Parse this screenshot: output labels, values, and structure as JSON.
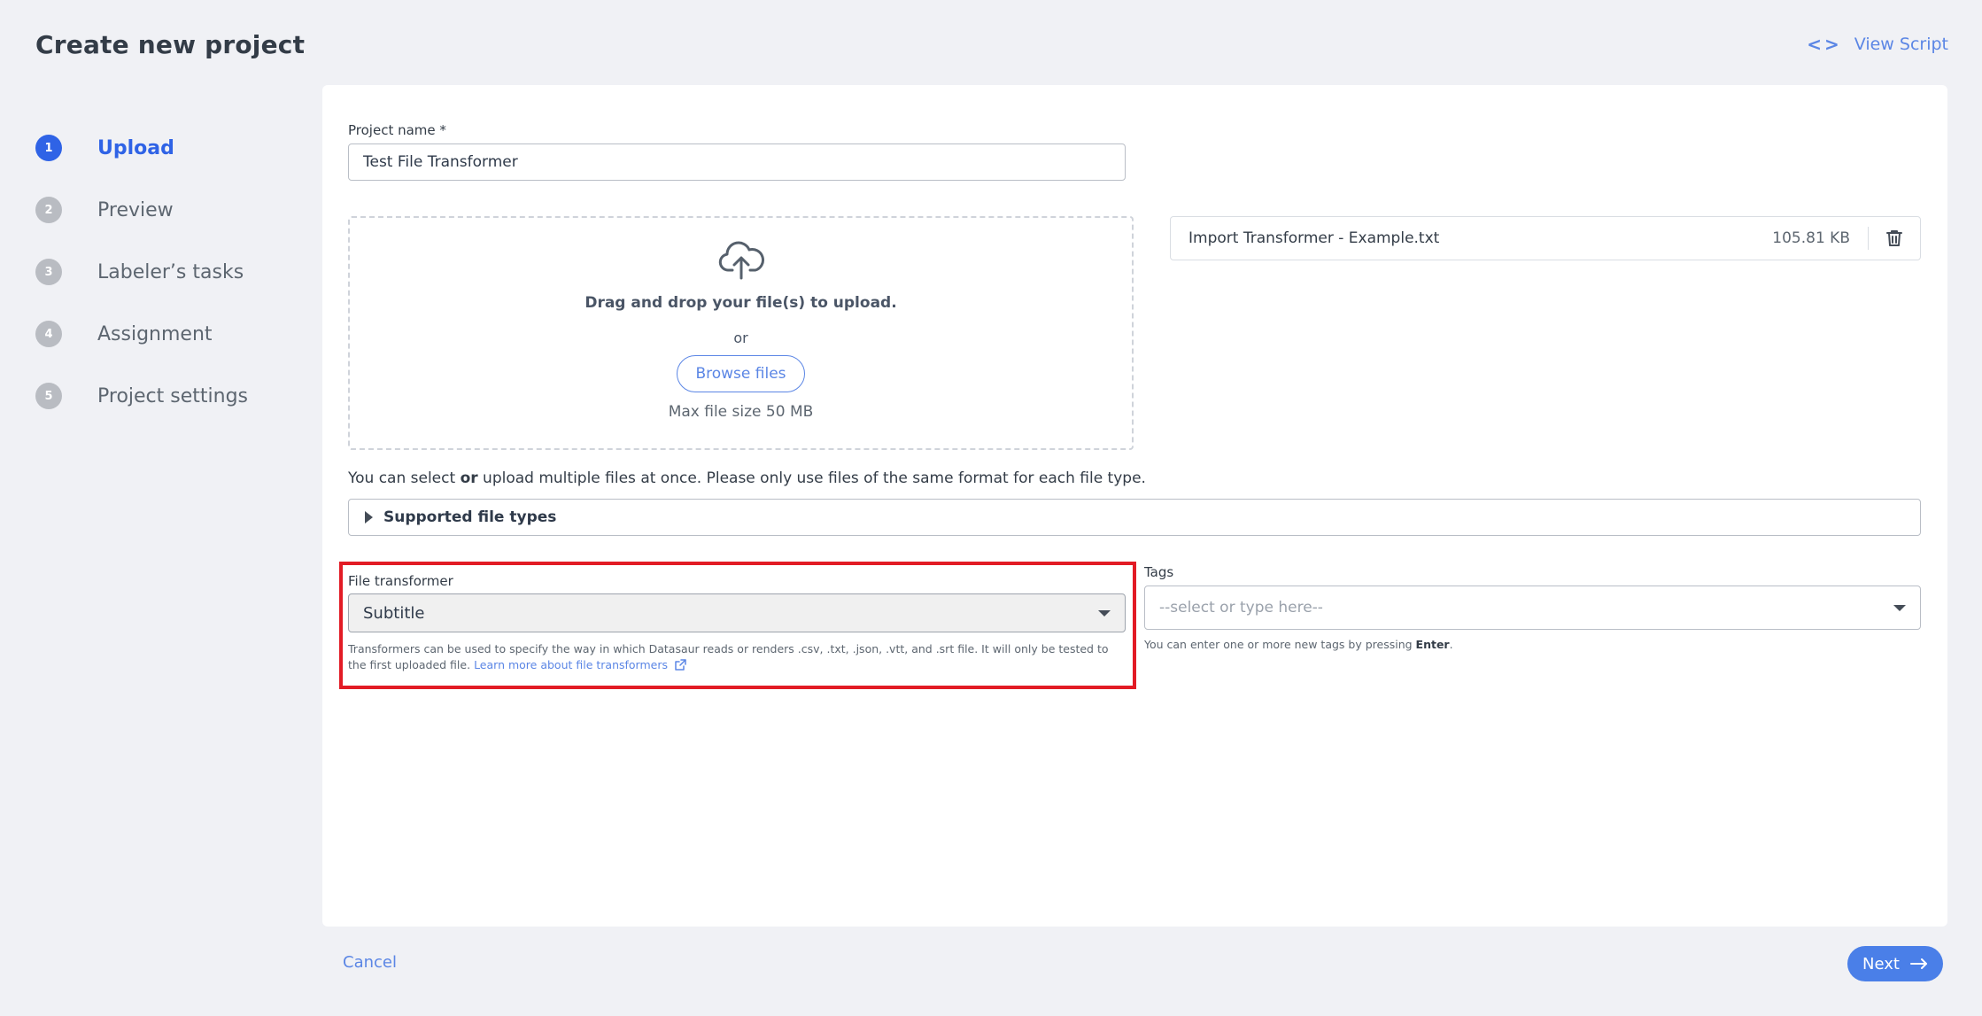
{
  "header": {
    "title": "Create new project",
    "view_script_label": "View Script",
    "view_script_icon": "code-icon"
  },
  "stepper": {
    "steps": [
      {
        "number": "1",
        "label": "Upload",
        "active": true
      },
      {
        "number": "2",
        "label": "Preview",
        "active": false
      },
      {
        "number": "3",
        "label": "Labeler’s tasks",
        "active": false
      },
      {
        "number": "4",
        "label": "Assignment",
        "active": false
      },
      {
        "number": "5",
        "label": "Project settings",
        "active": false
      }
    ]
  },
  "form": {
    "project_name": {
      "label": "Project name *",
      "value": "Test File Transformer"
    },
    "dropzone": {
      "icon": "cloud-upload-icon",
      "title": "Drag and drop your file(s) to upload.",
      "or_text": "or",
      "browse_label": "Browse files",
      "max_size": "Max file size 50 MB"
    },
    "uploaded_file": {
      "name": "Import Transformer - Example.txt",
      "size": "105.81 KB",
      "delete_icon": "trash-icon"
    },
    "select_note": {
      "before": "You can select ",
      "bold": "or",
      "after": " upload multiple files at once. Please only use files of the same format for each file type."
    },
    "supported_file_types": "Supported file types",
    "file_transformer": {
      "label": "File transformer",
      "value": "Subtitle",
      "help_text": "Transformers can be used to specify the way in which Datasaur reads or renders .csv, .txt, .json, .vtt, and .srt file. It will only be tested to the first uploaded file.",
      "learn_more": "Learn more about file transformers"
    },
    "tags": {
      "label": "Tags",
      "placeholder": "--select or type here--",
      "help_before": "You can enter one or more new tags by pressing ",
      "help_key": "Enter",
      "help_after": "."
    }
  },
  "footer": {
    "cancel_label": "Cancel",
    "next_label": "Next"
  },
  "colors": {
    "accent": "#2f63e6",
    "link": "#5b86e5",
    "highlight": "#e21b25",
    "background": "#f0f1f5"
  }
}
